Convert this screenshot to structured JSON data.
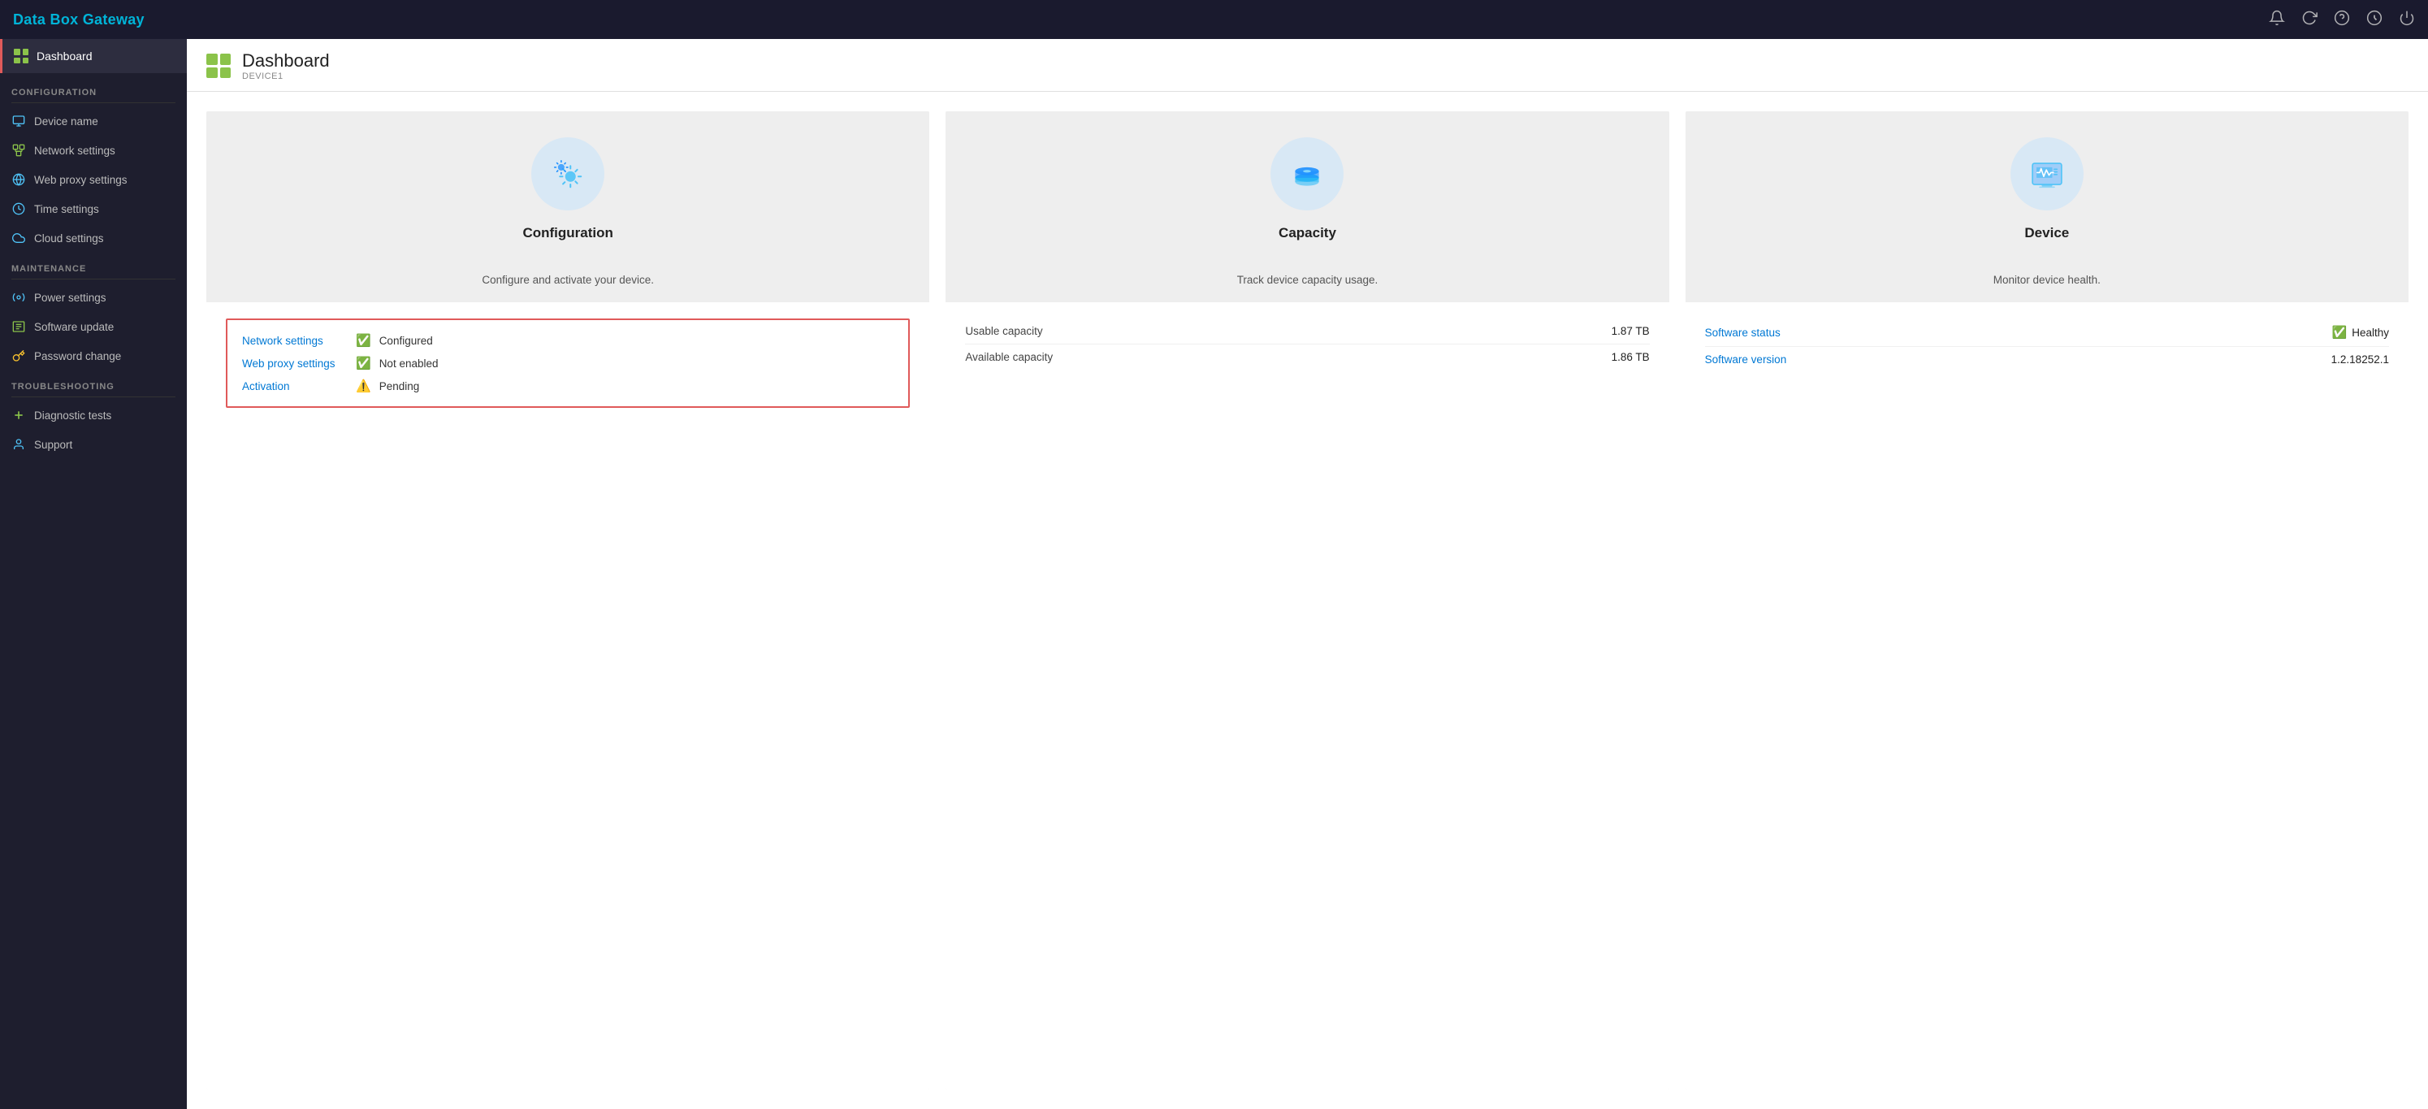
{
  "app": {
    "title": "Data Box Gateway"
  },
  "topbar": {
    "icons": [
      "bell",
      "refresh",
      "help",
      "power-circle",
      "power"
    ]
  },
  "sidebar": {
    "dashboard_label": "Dashboard",
    "sections": [
      {
        "label": "CONFIGURATION",
        "items": [
          {
            "id": "device-name",
            "label": "Device name",
            "icon": "🖥"
          },
          {
            "id": "network-settings",
            "label": "Network settings",
            "icon": "🔧"
          },
          {
            "id": "web-proxy-settings",
            "label": "Web proxy settings",
            "icon": "🌐"
          },
          {
            "id": "time-settings",
            "label": "Time settings",
            "icon": "🕐"
          },
          {
            "id": "cloud-settings",
            "label": "Cloud settings",
            "icon": "☁"
          }
        ]
      },
      {
        "label": "MAINTENANCE",
        "items": [
          {
            "id": "power-settings",
            "label": "Power settings",
            "icon": "⚙"
          },
          {
            "id": "software-update",
            "label": "Software update",
            "icon": "💾"
          },
          {
            "id": "password-change",
            "label": "Password change",
            "icon": "🔑"
          }
        ]
      },
      {
        "label": "TROUBLESHOOTING",
        "items": [
          {
            "id": "diagnostic-tests",
            "label": "Diagnostic tests",
            "icon": "➕"
          },
          {
            "id": "support",
            "label": "Support",
            "icon": "👤"
          }
        ]
      }
    ]
  },
  "header": {
    "title": "Dashboard",
    "subtitle": "DEVICE1"
  },
  "cards": {
    "configuration": {
      "title": "Configuration",
      "description": "Configure and activate your device.",
      "items": [
        {
          "id": "network-settings",
          "label": "Network settings",
          "status_icon": "✅",
          "status_text": "Configured"
        },
        {
          "id": "web-proxy-settings",
          "label": "Web proxy settings",
          "status_icon": "✅",
          "status_text": "Not enabled"
        },
        {
          "id": "activation",
          "label": "Activation",
          "status_icon": "⚠️",
          "status_text": "Pending"
        }
      ]
    },
    "capacity": {
      "title": "Capacity",
      "description": "Track device capacity usage.",
      "rows": [
        {
          "label": "Usable capacity",
          "value": "1.87 TB"
        },
        {
          "label": "Available capacity",
          "value": "1.86 TB"
        }
      ]
    },
    "device": {
      "title": "Device",
      "description": "Monitor device health.",
      "rows": [
        {
          "id": "software-status",
          "label": "Software status",
          "status_icon": "✅",
          "value": "Healthy"
        },
        {
          "id": "software-version",
          "label": "Software version",
          "value": "1.2.18252.1"
        }
      ]
    }
  },
  "colors": {
    "accent_blue": "#0078d4",
    "topbar_bg": "#1a1a2e",
    "sidebar_bg": "#1e1e2e",
    "sidebar_active": "#2d2d3f",
    "brand_cyan": "#00b4d8",
    "border_red": "#e05a5a",
    "icon_circle_bg": "#d8e8f5",
    "check_green": "#107c10",
    "warning_yellow": "#ffb900"
  }
}
